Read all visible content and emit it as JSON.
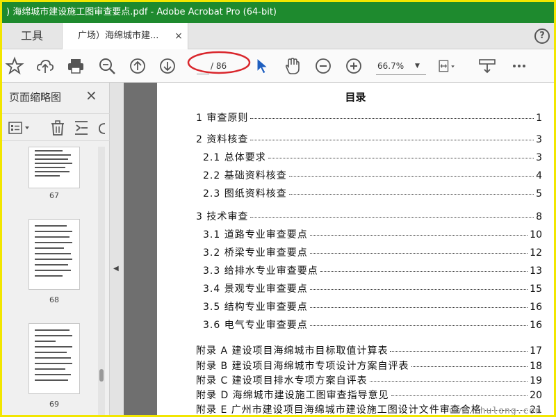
{
  "window": {
    "title": ") 海绵城市建设施工图审查要点.pdf - Adobe Acrobat Pro (64-bit)"
  },
  "tabs": {
    "tools_label": "工具",
    "doc_label": "广场）海绵城市建...",
    "close": "×",
    "help": "?"
  },
  "toolbar": {
    "page_current": "",
    "page_total": "/ 86",
    "zoom": "66.7%"
  },
  "left_panel": {
    "title": "页面缩略图",
    "close": "×",
    "thumbs": [
      {
        "num": "67"
      },
      {
        "num": "68"
      },
      {
        "num": "69"
      }
    ]
  },
  "document": {
    "toc_title": "目录",
    "items": [
      {
        "text": "1  审查原则",
        "page": "1"
      },
      {
        "text": "2 资料核查",
        "page": "3"
      },
      {
        "text": "2.1 总体要求",
        "page": "3"
      },
      {
        "text": "2.2 基础资料核查",
        "page": "4"
      },
      {
        "text": "2.3 图纸资料核查",
        "page": "5"
      },
      {
        "text": "3  技术审查",
        "page": "8"
      },
      {
        "text": "3.1  道路专业审查要点",
        "page": "10"
      },
      {
        "text": "3.2  桥梁专业审查要点",
        "page": "12"
      },
      {
        "text": "3.3  给排水专业审查要点",
        "page": "13"
      },
      {
        "text": "3.4  景观专业审查要点",
        "page": "15"
      },
      {
        "text": "3.5  结构专业审查要点",
        "page": "16"
      },
      {
        "text": "3.6  电气专业审查要点",
        "page": "16"
      },
      {
        "text": "附录 A   建设项目海绵城市目标取值计算表",
        "page": "17"
      },
      {
        "text": "附录 B   建设项目海绵城市专项设计方案自评表",
        "page": "18"
      },
      {
        "text": "附录 C   建设项目排水专项方案自评表",
        "page": "19"
      },
      {
        "text": "附录 D   海绵城市建设施工图审查指导意见",
        "page": "20"
      },
      {
        "text": "附录 E   广州市建设项目海绵城市建设施工图设计文件审查合格",
        "page": "21"
      }
    ],
    "watermark": "www.zhulong.com"
  },
  "colors": {
    "titlebar": "#1e8a2e",
    "frame": "#f2e600",
    "annotation": "#d9262c",
    "cursor": "#1f5fbf"
  }
}
